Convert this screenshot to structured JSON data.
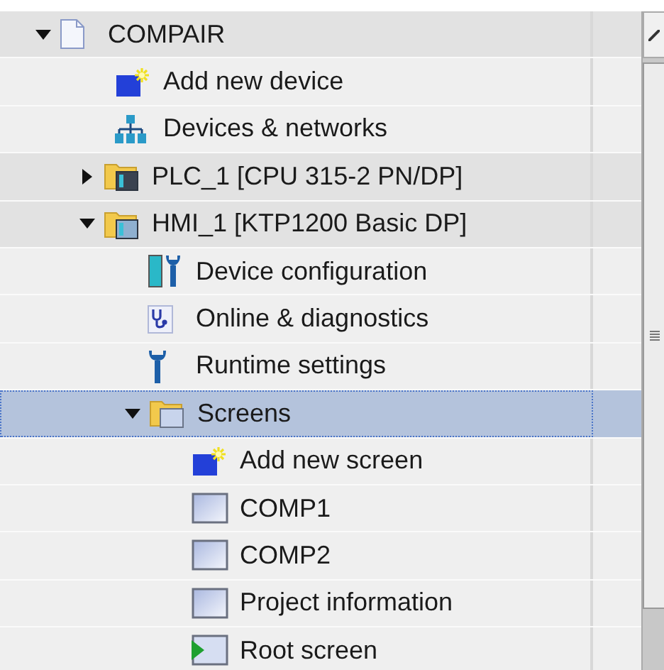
{
  "project_tree": [
    {
      "label": "COMPAIR",
      "kind": "project",
      "expanded": true,
      "selected": false,
      "children": [
        {
          "label": "Add new device",
          "kind": "add-device",
          "selected": false
        },
        {
          "label": "Devices & networks",
          "kind": "network",
          "selected": false
        },
        {
          "label": "PLC_1 [CPU 315-2 PN/DP]",
          "kind": "plc-folder",
          "expanded": false,
          "selected": false
        },
        {
          "label": "HMI_1 [KTP1200 Basic DP]",
          "kind": "hmi-folder",
          "expanded": true,
          "selected": false,
          "children": [
            {
              "label": "Device configuration",
              "kind": "device-config",
              "selected": false
            },
            {
              "label": "Online & diagnostics",
              "kind": "diagnostics",
              "selected": false
            },
            {
              "label": "Runtime settings",
              "kind": "runtime-settings",
              "selected": false
            },
            {
              "label": "Screens",
              "kind": "folder",
              "expanded": true,
              "selected": true,
              "children": [
                {
                  "label": "Add new screen",
                  "kind": "add-screen",
                  "selected": false
                },
                {
                  "label": "COMP1",
                  "kind": "screen",
                  "selected": false
                },
                {
                  "label": "COMP2",
                  "kind": "screen",
                  "selected": false
                },
                {
                  "label": "Project information",
                  "kind": "screen",
                  "selected": false
                },
                {
                  "label": "Root screen",
                  "kind": "root-screen",
                  "selected": false
                }
              ]
            }
          ]
        }
      ]
    }
  ]
}
